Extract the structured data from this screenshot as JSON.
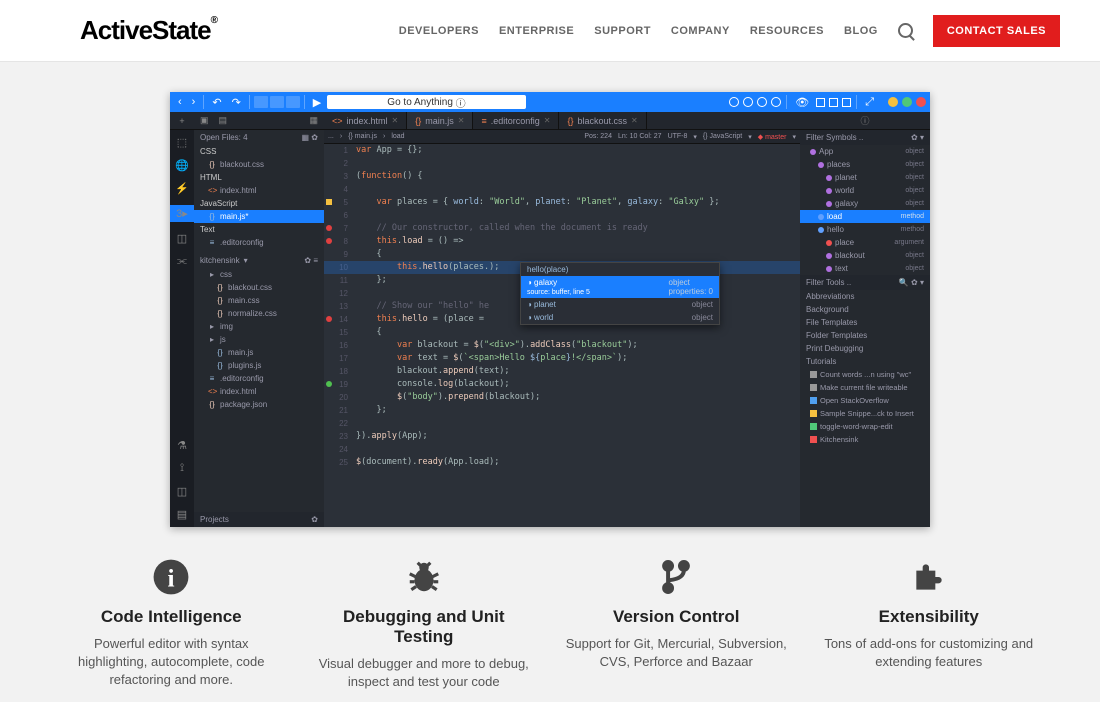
{
  "brand": "ActiveState",
  "nav": [
    "DEVELOPERS",
    "ENTERPRISE",
    "SUPPORT",
    "COMPANY",
    "RESOURCES",
    "BLOG"
  ],
  "contact": "CONTACT SALES",
  "goto": "Go to Anything",
  "tabs": [
    {
      "icon": "<>",
      "name": "index.html"
    },
    {
      "icon": "{}",
      "name": "main.js",
      "active": true
    },
    {
      "icon": "≡",
      "name": ".editorconfig"
    },
    {
      "icon": "{}",
      "name": "blackout.css"
    }
  ],
  "openFiles": {
    "title": "Open Files: 4",
    "groups": [
      {
        "name": "CSS",
        "items": [
          {
            "icon": "{}",
            "name": "blackout.css",
            "color": "#ecb"
          }
        ]
      },
      {
        "name": "HTML",
        "items": [
          {
            "icon": "<>",
            "name": "index.html",
            "color": "#f08050"
          }
        ]
      },
      {
        "name": "JavaScript",
        "items": [
          {
            "icon": "{}",
            "name": "main.js*",
            "sel": true,
            "color": "#9bd"
          }
        ]
      },
      {
        "name": "Text",
        "items": [
          {
            "icon": "≡",
            "name": ".editorconfig",
            "color": "#9bd"
          }
        ]
      }
    ]
  },
  "project": {
    "name": "kitchensink",
    "root": [
      {
        "icon": "▸",
        "name": "css",
        "folder": true
      },
      {
        "icon": "{}",
        "name": "blackout.css",
        "indent": 2,
        "color": "#ecb"
      },
      {
        "icon": "{}",
        "name": "main.css",
        "indent": 2,
        "color": "#ecb"
      },
      {
        "icon": "{}",
        "name": "normalize.css",
        "indent": 2,
        "color": "#ecb"
      },
      {
        "icon": "▸",
        "name": "img",
        "folder": true
      },
      {
        "icon": "▸",
        "name": "js",
        "folder": true
      },
      {
        "icon": "{}",
        "name": "main.js",
        "indent": 2,
        "color": "#9bd"
      },
      {
        "icon": "{}",
        "name": "plugins.js",
        "indent": 2,
        "color": "#9bd"
      },
      {
        "icon": "≡",
        "name": ".editorconfig",
        "indent": 1,
        "color": "#9bd"
      },
      {
        "icon": "<>",
        "name": "index.html",
        "indent": 1,
        "color": "#f08050"
      },
      {
        "icon": "{}",
        "name": "package.json",
        "indent": 1,
        "color": "#ecb"
      }
    ],
    "footer": "Projects"
  },
  "crumb": [
    "...",
    "{} main.js",
    "load"
  ],
  "info": {
    "pos": "Pos: 224",
    "ln": "Ln: 10 Col: 27",
    "enc": "UTF-8",
    "lang": "{} JavaScript",
    "branch": "master"
  },
  "code": [
    {
      "n": 1,
      "t": "<span class='k'>var</span> App = {};"
    },
    {
      "n": 2,
      "t": ""
    },
    {
      "n": 3,
      "t": "(<span class='k'>function</span>() {"
    },
    {
      "n": 4,
      "t": ""
    },
    {
      "n": 5,
      "bp": "warn",
      "t": "    <span class='k'>var</span> places = { <span class='pr'>world</span>: <span class='s'>\"World\"</span>, <span class='pr'>planet</span>: <span class='s'>\"Planet\"</span>, <span class='pr'>galaxy</span>: <span class='s'>\"Galxy\"</span> };"
    },
    {
      "n": 6,
      "t": ""
    },
    {
      "n": 7,
      "bp": "bp",
      "t": "    <span class='c'>// Our constructor, called when the document is ready</span>"
    },
    {
      "n": 8,
      "bp": "bp",
      "t": "    <span class='k'>this</span>.<span class='fn'>load</span> = () =>"
    },
    {
      "n": 9,
      "t": "    {"
    },
    {
      "n": 10,
      "hl": true,
      "t": "        <span class='k'>this</span>.<span class='fn'>hello</span>(places.);"
    },
    {
      "n": 11,
      "t": "    };"
    },
    {
      "n": 12,
      "t": ""
    },
    {
      "n": 13,
      "t": "    <span class='c'>// Show our \"hello\" he</span>"
    },
    {
      "n": 14,
      "bp": "bp",
      "t": "    <span class='k'>this</span>.<span class='fn'>hello</span> = (place ="
    },
    {
      "n": 15,
      "t": "    {"
    },
    {
      "n": 16,
      "t": "        <span class='k'>var</span> blackout = <span class='fn'>$</span>(<span class='s'>\"&lt;div&gt;\"</span>).<span class='fn'>addClass</span>(<span class='s'>\"blackout\"</span>);"
    },
    {
      "n": 17,
      "t": "        <span class='k'>var</span> text = <span class='fn'>$</span>(<span class='s'>`&lt;span&gt;Hello <span class='pr'>${</span>place<span class='pr'>}</span>!&lt;/span&gt;`</span>);"
    },
    {
      "n": 18,
      "t": "        blackout.<span class='fn'>append</span>(text);"
    },
    {
      "n": 19,
      "bp": "bpg",
      "t": "        console.<span class='fn'>log</span>(blackout);"
    },
    {
      "n": 20,
      "t": "        <span class='fn'>$</span>(<span class='s'>\"body\"</span>).<span class='fn'>prepend</span>(blackout);"
    },
    {
      "n": 21,
      "t": "    };"
    },
    {
      "n": 22,
      "t": ""
    },
    {
      "n": 23,
      "t": "}).<span class='fn'>apply</span>(App);"
    },
    {
      "n": 24,
      "t": ""
    },
    {
      "n": 25,
      "t": "<span class='fn'>$</span>(document).<span class='fn'>ready</span>(App.load);"
    }
  ],
  "popup": {
    "head": "hello(place)",
    "items": [
      {
        "name": "galaxy",
        "sel": true,
        "sub": "source: buffer, line 5",
        "type": "object",
        "props": "properties: 0"
      },
      {
        "name": "planet",
        "type": "object"
      },
      {
        "name": "world",
        "type": "object"
      }
    ]
  },
  "symbols": {
    "title": "Filter Symbols ..",
    "items": [
      {
        "d": "#b070e0",
        "name": "App",
        "t": "object",
        "i": 0
      },
      {
        "d": "#b070e0",
        "name": "places",
        "t": "object",
        "i": 1
      },
      {
        "d": "#b070e0",
        "name": "planet",
        "t": "object",
        "i": 2
      },
      {
        "d": "#b070e0",
        "name": "world",
        "t": "object",
        "i": 2
      },
      {
        "d": "#b070e0",
        "name": "galaxy",
        "t": "object",
        "i": 2
      },
      {
        "d": "#60a0ff",
        "name": "load",
        "t": "method",
        "i": 1,
        "sel": true
      },
      {
        "d": "#60a0ff",
        "name": "hello",
        "t": "method",
        "i": 1
      },
      {
        "d": "#f05050",
        "name": "place",
        "t": "argument",
        "i": 2
      },
      {
        "d": "#b070e0",
        "name": "blackout",
        "t": "object",
        "i": 2
      },
      {
        "d": "#b070e0",
        "name": "text",
        "t": "object",
        "i": 2
      }
    ]
  },
  "tools": {
    "title": "Filter Tools ..",
    "items": [
      "Abbreviations",
      "Background",
      "File Templates",
      "Folder Templates",
      "Print Debugging",
      "Tutorials"
    ]
  },
  "macros": [
    {
      "c": "#999",
      "name": "Count words ...n using \"wc\""
    },
    {
      "c": "#999",
      "name": "Make current file writeable"
    },
    {
      "c": "#50a0f0",
      "name": "Open StackOverflow"
    },
    {
      "c": "#f5c040",
      "name": "Sample Snippe...ck to Insert"
    },
    {
      "c": "#50c878",
      "name": "toggle-word-wrap-edit"
    },
    {
      "c": "#f05050",
      "name": "Kitchensink"
    }
  ],
  "features": [
    {
      "icon": "info",
      "title": "Code Intelligence",
      "desc": "Powerful editor with syntax highlighting, autocomplete, code refactoring and more."
    },
    {
      "icon": "bug",
      "title": "Debugging and Unit Testing",
      "desc": "Visual debugger and more to debug, inspect and test your code"
    },
    {
      "icon": "branch",
      "title": "Version Control",
      "desc": "Support for Git, Mercurial, Subversion, CVS, Perforce and Bazaar"
    },
    {
      "icon": "puzzle",
      "title": "Extensibility",
      "desc": "Tons of add-ons for customizing and extending features"
    }
  ]
}
